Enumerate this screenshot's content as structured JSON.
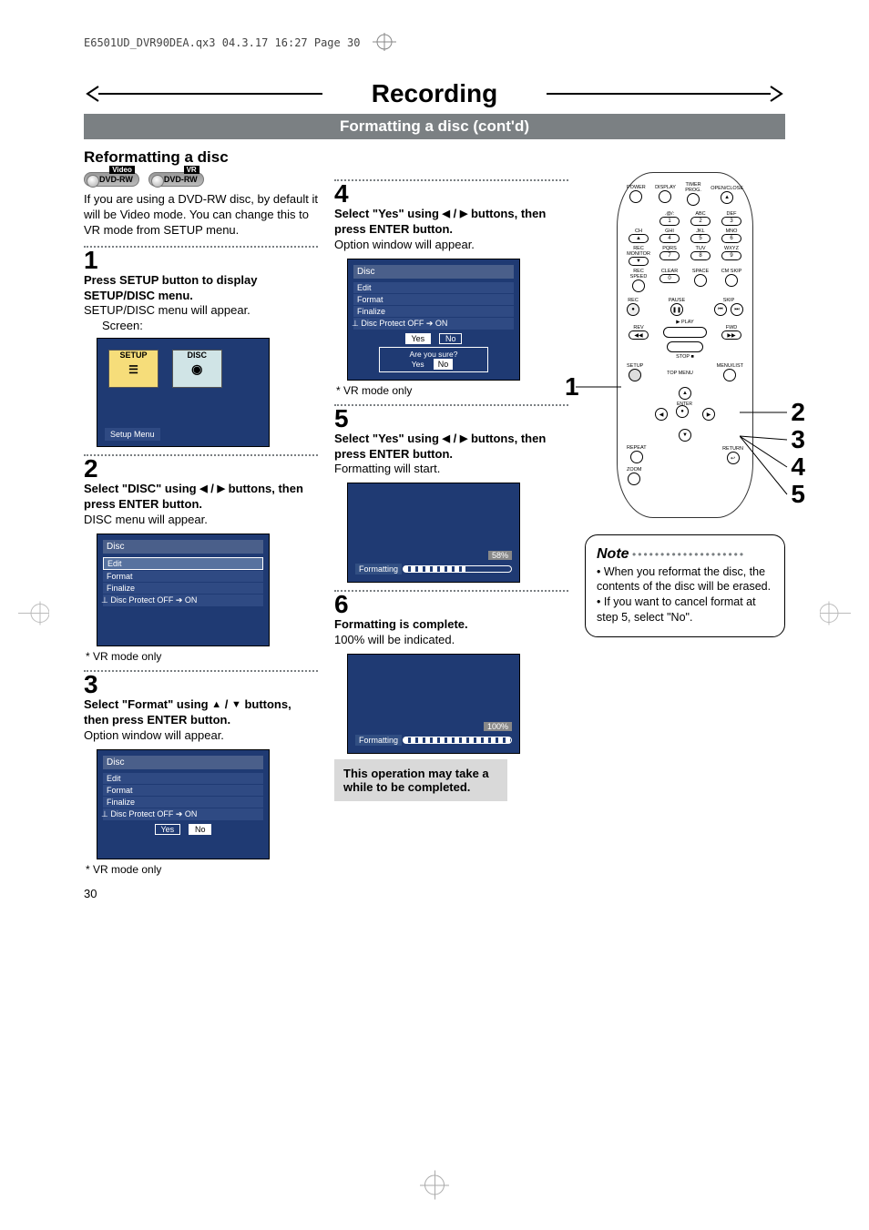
{
  "meta": {
    "crop_line": "E6501UD_DVR90DEA.qx3  04.3.17  16:27  Page 30"
  },
  "title": "Recording",
  "subband": "Formatting a disc (cont'd)",
  "section": "Reformatting a disc",
  "badges": {
    "video": "DVD-RW",
    "video_tag": "Video",
    "vr": "DVD-RW",
    "vr_tag": "VR"
  },
  "intro": "If you are using a DVD-RW disc, by default it will be Video mode. You can change this to VR mode from SETUP menu.",
  "steps": {
    "s1": {
      "num": "1",
      "bold": "Press SETUP button to display SETUP/DISC menu.",
      "text": "SETUP/DISC menu will appear.",
      "screen_label": "Screen:",
      "screen": {
        "tile1": "SETUP",
        "tile2": "DISC",
        "label": "Setup Menu"
      }
    },
    "s2": {
      "num": "2",
      "bold_pre": "Select \"DISC\" using ",
      "bold_mid": " / ",
      "bold_post": " buttons, then press ENTER button.",
      "text": "DISC menu will appear.",
      "menu": {
        "title": "Disc",
        "rows": [
          "Edit",
          "Format",
          "Finalize",
          "Disc Protect OFF ➔ ON"
        ]
      },
      "footnote": "* VR mode only"
    },
    "s3": {
      "num": "3",
      "bold_pre": "Select \"Format\" using ",
      "bold_mid": " / ",
      "bold_post": " buttons, then press ENTER button.",
      "text": "Option window will appear.",
      "menu": {
        "title": "Disc",
        "rows": [
          "Edit",
          "Format",
          "Finalize",
          "Disc Protect OFF ➔ ON"
        ],
        "yes": "Yes",
        "no": "No"
      },
      "footnote": "* VR mode only"
    },
    "s4": {
      "num": "4",
      "bold_pre": "Select \"Yes\" using ",
      "bold_mid": " / ",
      "bold_post": " buttons, then press ENTER button.",
      "text": "Option window will appear.",
      "menu": {
        "title": "Disc",
        "rows": [
          "Edit",
          "Format",
          "Finalize",
          "Disc Protect OFF ➔ ON"
        ],
        "yes": "Yes",
        "no": "No",
        "confirm": "Are you sure?",
        "yes2": "Yes",
        "no2": "No"
      },
      "footnote": "* VR mode only"
    },
    "s5": {
      "num": "5",
      "bold_pre": "Select \"Yes\" using ",
      "bold_mid": " / ",
      "bold_post": " buttons, then press ENTER button.",
      "text": "Formatting will start.",
      "progress": {
        "label": "Formatting",
        "pct": "58%",
        "fill": 58
      }
    },
    "s6": {
      "num": "6",
      "bold": "Formatting is complete.",
      "text": "100% will be indicated.",
      "progress": {
        "label": "Formatting",
        "pct": "100%",
        "fill": 100
      }
    }
  },
  "warn": "This operation may take a while to be completed.",
  "note": {
    "title": "Note",
    "items": [
      "When you reformat the disc, the contents of the disc will be erased.",
      "If you want to cancel format at step 5, select \"No\"."
    ]
  },
  "remote": {
    "labels": {
      "power": "POWER",
      "display": "DISPLAY",
      "timer": "TIMER\nPROG.",
      "open": "OPEN/CLOSE",
      "at": ".@/:",
      "abc": "ABC",
      "def": "DEF",
      "ch": "CH",
      "ghi": "GHI",
      "jkl": "JKL",
      "mno": "MNO",
      "monitor": "REC\nMONITOR",
      "pqrs": "PQRS",
      "tuv": "TUV",
      "wxyz": "WXYZ",
      "recspeed": "REC SPEED",
      "clear": "CLEAR",
      "space": "SPACE",
      "cmskip": "CM SKIP",
      "rec": "REC",
      "pause": "PAUSE",
      "skip": "SKIP",
      "play": "PLAY",
      "rev": "REV",
      "fwd": "FWD",
      "stop": "STOP",
      "setup": "SETUP",
      "topmenu": "TOP MENU",
      "menulist": "MENU/LIST",
      "repeat": "REPEAT",
      "enter": "ENTER",
      "return": "RETURN",
      "zoom": "ZOOM"
    },
    "nums": {
      "n1": "1",
      "n2": "2",
      "n3": "3",
      "n4": "4",
      "n5": "5",
      "n6": "6",
      "n7": "7",
      "n8": "8",
      "n9": "9",
      "n0": "0"
    }
  },
  "callouts": {
    "c1": "1",
    "c2": "2",
    "c3": "3",
    "c4": "4",
    "c5": "5"
  },
  "page_num": "30"
}
